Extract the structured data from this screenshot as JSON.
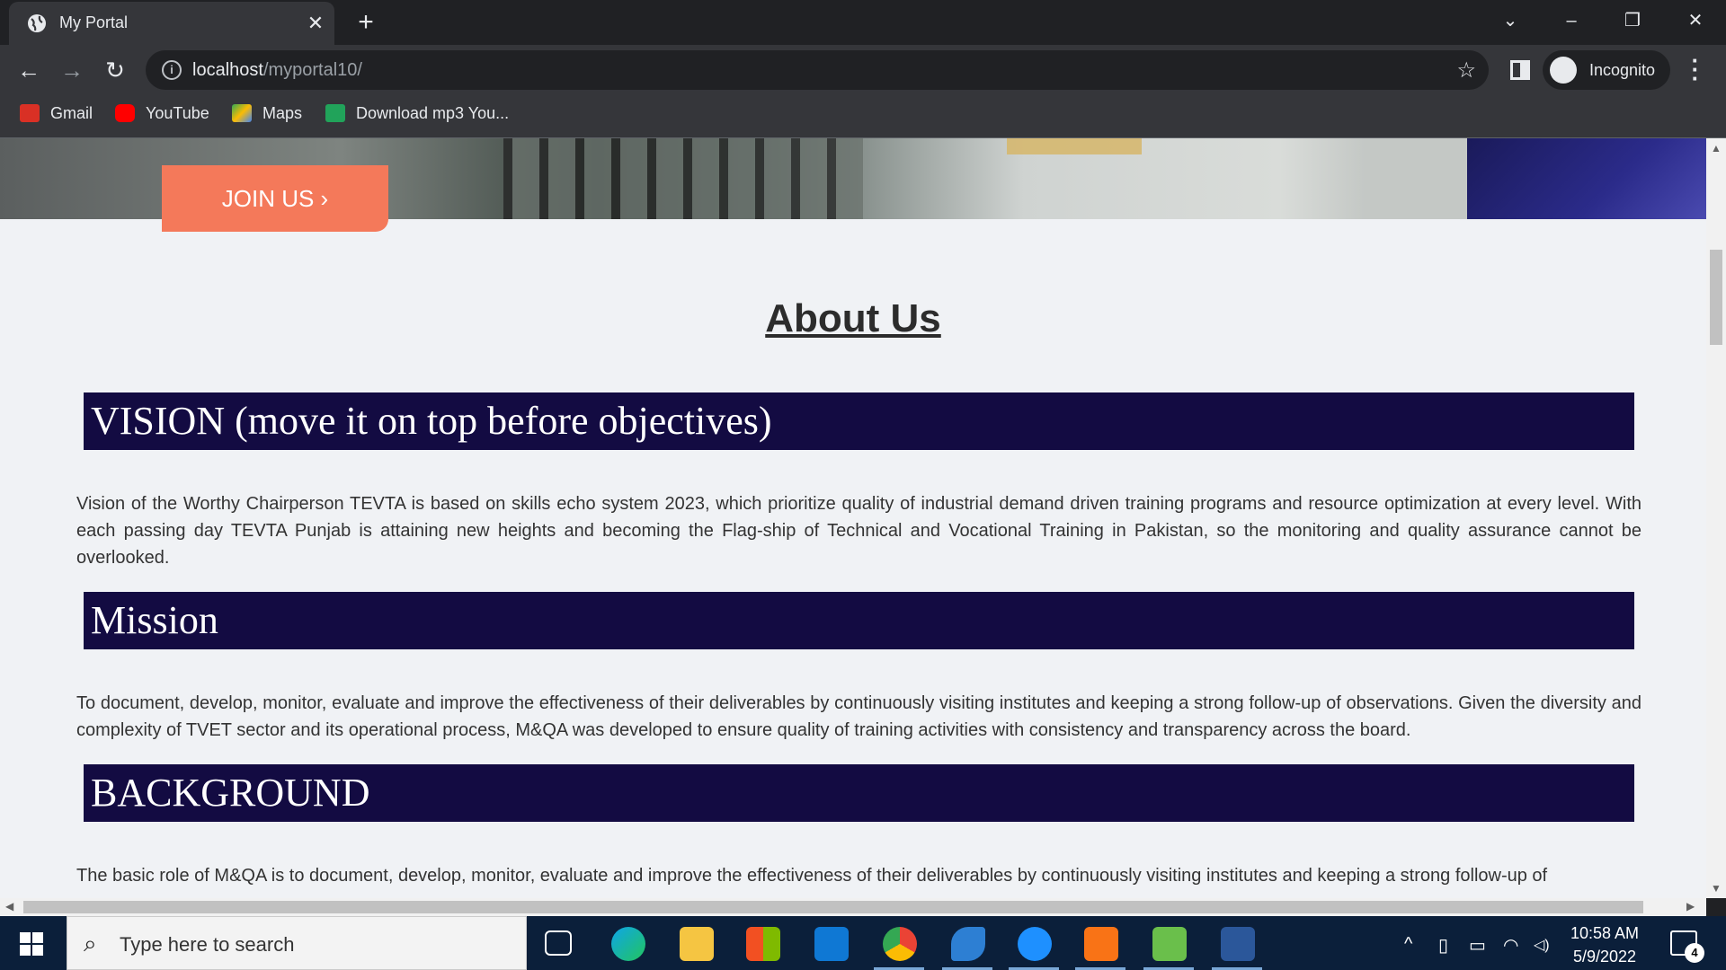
{
  "browser": {
    "tab_title": "My Portal",
    "tab_close": "✕",
    "new_tab": "+",
    "url_host": "localhost",
    "url_path": "/myportal10/",
    "incognito_label": "Incognito",
    "bookmarks": [
      {
        "label": "Gmail",
        "color": "#d93025"
      },
      {
        "label": "YouTube",
        "color": "#ff0000"
      },
      {
        "label": "Maps",
        "color": "#34a853"
      },
      {
        "label": "Download mp3 You...",
        "color": "#21a35a"
      }
    ]
  },
  "page": {
    "join_button": "JOIN US ›",
    "about_heading": "About Us",
    "sections": [
      {
        "heading": "VISION (move it on top before objectives)",
        "text": "Vision of the Worthy Chairperson TEVTA is based on skills echo system 2023, which prioritize quality of industrial demand driven training programs and resource optimization at every level. With each passing day TEVTA Punjab is attaining new heights and becoming the Flag-ship of Technical and Vocational Training in Pakistan, so the monitoring and quality assurance cannot be overlooked."
      },
      {
        "heading": "Mission",
        "text": "To document, develop, monitor, evaluate and improve the effectiveness of their deliverables by continuously visiting institutes and keeping a strong follow-up of observations. Given the diversity and complexity of TVET sector and its operational process, M&QA was developed to ensure quality of training activities with consistency and transparency across the board."
      },
      {
        "heading": "BACKGROUND",
        "text": "The basic role of M&QA is to document, develop, monitor, evaluate and improve the effectiveness of their deliverables by continuously visiting institutes and keeping a strong follow-up of"
      }
    ],
    "band_color": "#130b42",
    "accent_color": "#f4795a"
  },
  "taskbar": {
    "search_placeholder": "Type here to search",
    "time": "10:58 AM",
    "date": "5/9/2022",
    "notification_count": "4"
  }
}
